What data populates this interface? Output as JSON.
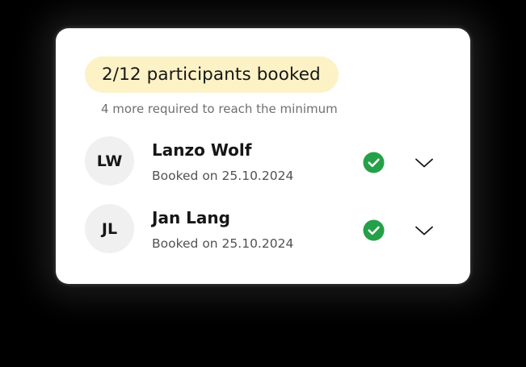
{
  "summary": {
    "badge_text": "2/12 participants booked",
    "subtext": "4 more required to reach the minimum"
  },
  "participants": [
    {
      "initials": "LW",
      "name": "Lanzo Wolf",
      "booked_text": "Booked on 25.10.2024",
      "status_icon": "check-circle-icon",
      "expand_icon": "chevron-down-icon"
    },
    {
      "initials": "JL",
      "name": "Jan Lang",
      "booked_text": "Booked on 25.10.2024",
      "status_icon": "check-circle-icon",
      "expand_icon": "chevron-down-icon"
    }
  ],
  "colors": {
    "badge_background": "#fcf2c6",
    "check_green": "#24a148",
    "avatar_background": "#f0f0f0",
    "text_primary": "#161616",
    "text_secondary": "#6f6f6f"
  }
}
